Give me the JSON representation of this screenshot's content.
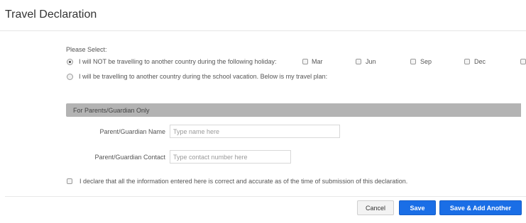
{
  "header": {
    "title": "Travel Declaration"
  },
  "form": {
    "select_label": "Please Select:",
    "options": [
      {
        "label": "I will NOT be travelling to another country during the following holiday:",
        "selected": true
      },
      {
        "label": "I will be travelling to another country during the school vacation. Below is my travel plan:",
        "selected": false
      }
    ],
    "months": [
      "Mar",
      "Jun",
      "Sep",
      "Dec"
    ],
    "guardian_section": {
      "title": "For Parents/Guardian Only",
      "name_label": "Parent/Guardian Name",
      "name_placeholder": "Type name here",
      "contact_label": "Parent/Guardian Contact",
      "contact_placeholder": "Type contact number here"
    },
    "declaration": "I declare that all the information entered here is correct and accurate as of the time of submission of this declaration."
  },
  "buttons": {
    "cancel": "Cancel",
    "save": "Save",
    "save_add": "Save & Add Another"
  },
  "colors": {
    "primary": "#1a6ee6",
    "section_bar": "#b3b3b3"
  }
}
